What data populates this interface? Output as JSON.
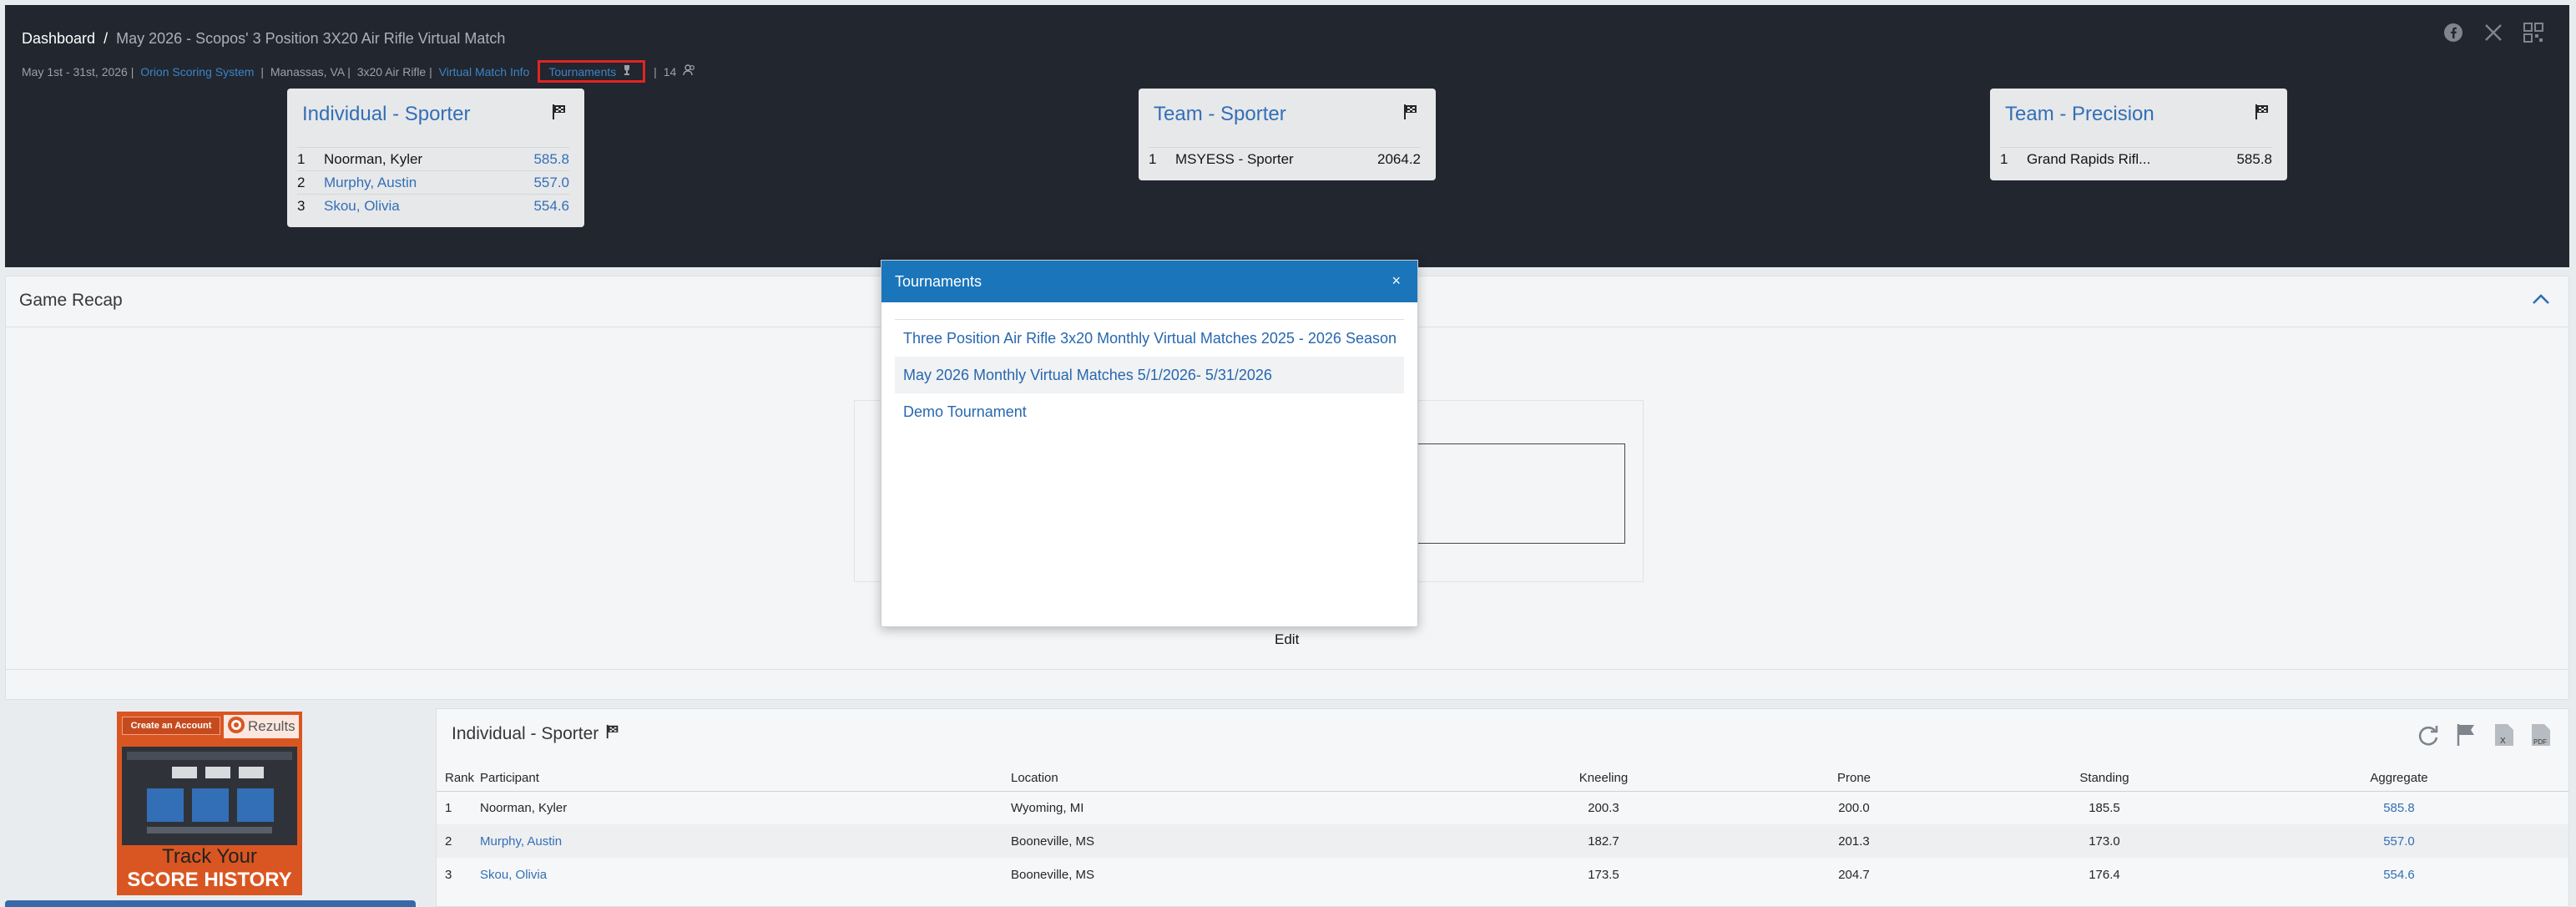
{
  "breadcrumb": {
    "home": "Dashboard",
    "separator": "/",
    "current": "May 2026 - Scopos' 3 Position 3X20 Air Rifle Virtual Match"
  },
  "meta": {
    "dates": "May 1st - 31st, 2026 |",
    "system": "Orion Scoring System",
    "sep1": "|",
    "location": "Manassas, VA |",
    "discipline": "3x20 Air Rifle |",
    "match_info": "Virtual Match Info",
    "tournaments": "Tournaments",
    "sep2": "|",
    "participants": "14"
  },
  "header_icons": [
    "facebook-icon",
    "x-icon",
    "qr-code-icon"
  ],
  "cards": [
    {
      "title": "Individual - Sporter",
      "rows": [
        {
          "rank": "1",
          "name": "Noorman, Kyler",
          "score": "585.8",
          "name_link": false
        },
        {
          "rank": "2",
          "name": "Murphy, Austin",
          "score": "557.0",
          "name_link": true
        },
        {
          "rank": "3",
          "name": "Skou, Olivia",
          "score": "554.6",
          "name_link": true
        }
      ]
    },
    {
      "title": "Team - Sporter",
      "rows": [
        {
          "rank": "1",
          "name": "MSYESS - Sporter",
          "score": "2064.2",
          "name_link": false
        }
      ]
    },
    {
      "title": "Team - Precision",
      "rows": [
        {
          "rank": "1",
          "name": "Grand Rapids Rifl...",
          "score": "585.8",
          "name_link": false
        }
      ]
    }
  ],
  "recap": {
    "title": "Game Recap",
    "edit_label": "Edit"
  },
  "ad": {
    "create_account": "Create an Account",
    "brand": "Rezults",
    "line1": "Track Your",
    "line2": "SCORE HISTORY"
  },
  "results": {
    "title": "Individual - Sporter",
    "columns": [
      "Rank",
      "Participant",
      "Location",
      "Kneeling",
      "Prone",
      "Standing",
      "Aggregate"
    ],
    "rows": [
      {
        "rank": "1",
        "participant": "Noorman, Kyler",
        "location": "Wyoming, MI",
        "kneeling": "200.3",
        "prone": "200.0",
        "standing": "185.5",
        "aggregate": "585.8"
      },
      {
        "rank": "2",
        "participant": "Murphy, Austin",
        "location": "Booneville, MS",
        "kneeling": "182.7",
        "prone": "201.3",
        "standing": "173.0",
        "aggregate": "557.0"
      },
      {
        "rank": "3",
        "participant": "Skou, Olivia",
        "location": "Booneville, MS",
        "kneeling": "173.5",
        "prone": "204.7",
        "standing": "176.4",
        "aggregate": "554.6"
      }
    ]
  },
  "modal": {
    "title": "Tournaments",
    "close": "×",
    "items": [
      "Three Position Air Rifle 3x20 Monthly Virtual Matches 2025 - 2026 Season",
      "May 2026 Monthly Virtual Matches 5/1/2026- 5/31/2026",
      "Demo Tournament"
    ]
  },
  "colors": {
    "header_bg": "#1d222b",
    "link": "#2f6db5",
    "modal_header": "#1a75bb",
    "highlight_box": "#e02020",
    "ad_orange": "#d9531e"
  }
}
